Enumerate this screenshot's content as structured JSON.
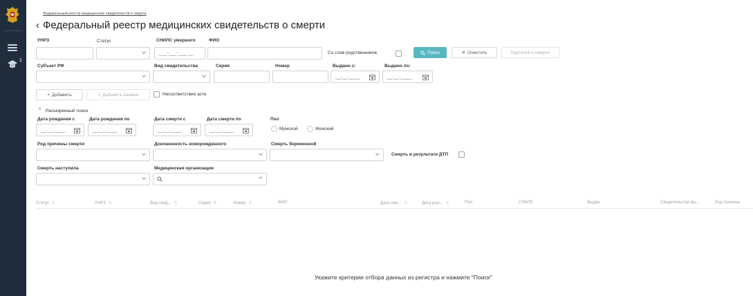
{
  "sidebar": {
    "logo_icon": "emblem-icon",
    "menu_icon": "hamburger-icon",
    "edu_icon": "graduation-cap-icon",
    "badge": "1"
  },
  "breadcrumb": "Федеральный реестр медицинских свидетельств о смерти",
  "page_title": "Федеральный реестр медицинских свидетельств о смерти",
  "search": {
    "unrz_label": "УНРЗ",
    "status_label": "Статус",
    "snils_label": "СНИЛС умершего",
    "snils_placeholder": "___-___-___ __",
    "fio_label": "ФИО",
    "relatives_label": "Со слов родственников",
    "search_button": "Поиск",
    "clear_button": "Очистить",
    "card_button": "Карточка о смерти",
    "subject_label": "Субъект РФ",
    "cert_type_label": "Вид свидетельства",
    "series_label": "Серия",
    "number_label": "Номер",
    "issued_from_label": "Выдано с:",
    "issued_to_label": "Выдано по:",
    "date_placeholder": "__.__.____"
  },
  "actions": {
    "add_button": "Добавить",
    "add_instead_button": "Добавить взамен",
    "mismatch_label": "Несоответствие асте"
  },
  "advanced": {
    "toggle_label": "Расширенный поиск",
    "birth_from_label": "Дата рождения с",
    "birth_to_label": "Дата рождения по",
    "death_from_label": "Дата смерти с",
    "death_to_label": "Дата смерти по",
    "sex_label": "Пол",
    "male_label": "Мужской",
    "female_label": "Женский",
    "death_cause_type_label": "Род причины смерти",
    "newborn_term_label": "Доношенность новорожденного",
    "pregnant_death_label": "Смерть беременной",
    "road_accident_label": "Смерть в результате ДТП",
    "death_occurred_label": "Смерть наступила",
    "med_org_label": "Медицинская организация"
  },
  "table": {
    "columns": [
      "Статус",
      "УНРЗ",
      "Вид свид...",
      "Серия",
      "Номер",
      "ФИО",
      "Дата сме...",
      "Дата рож...",
      "Пол",
      "СНИЛС",
      "Выдан",
      "Свидетельство вы...",
      "Род причины"
    ],
    "empty_message": "Укажите критерии отбора данных из регистра и нажмите \"Поиск\""
  },
  "colors": {
    "sidebar": "#1f2d3d",
    "accent": "#59b7c1"
  }
}
